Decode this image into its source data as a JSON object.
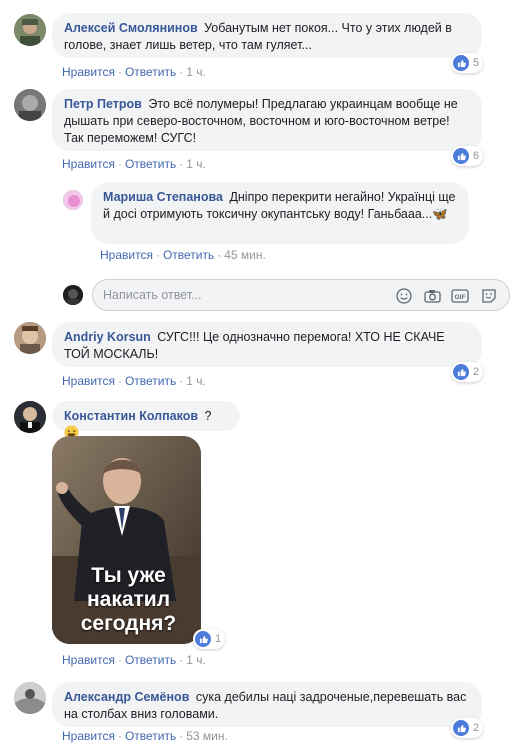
{
  "comments": [
    {
      "author": "Алексей Смолянинов",
      "text": "Уобанутым нет покоя... Что у этих людей в голове, знает лишь ветер, что там гуляет...",
      "like_label": "Нравится",
      "reply_label": "Ответить",
      "time": "1 ч.",
      "reactions": "5"
    },
    {
      "author": "Петр Петров",
      "text": "Это всё полумеры! Предлагаю украинцам вообще не дышать при северо-восточном, восточном и юго-восточном ветре! Так переможем! СУГС!",
      "like_label": "Нравится",
      "reply_label": "Ответить",
      "time": "1 ч.",
      "reactions": "6"
    },
    {
      "author": "Andriy Korsun",
      "text": "СУГС!!! Це однозначно перемога! ХТО НЕ СКАЧЕ ТОЙ МОСКАЛЬ!",
      "like_label": "Нравится",
      "reply_label": "Ответить",
      "time": "1 ч.",
      "reactions": "2"
    },
    {
      "author": "Константин Колпаков",
      "text": "?",
      "like_label": "Нравится",
      "reply_label": "Ответить",
      "time": "1 ч.",
      "reactions": "1",
      "photo_caption": "Ты уже накатил сегодня?"
    },
    {
      "author": "Александр Семёнов",
      "text": "сука дебилы нацi задроченые,перевешать вас на столбах вниз головами.",
      "like_label": "Нравится",
      "reply_label": "Ответить",
      "time": "53 мин.",
      "reactions": "2"
    }
  ],
  "reply": {
    "author": "Мариша Степанова",
    "text": "Дніпро перекрити негайно! Українці ще й досі отримують токсичну окупантську воду! Ганьбааа...🦋",
    "like_label": "Нравится",
    "reply_label": "Ответить",
    "time": "45 мин."
  },
  "reply_input": {
    "placeholder": "Написать ответ..."
  },
  "icons": [
    "like-icon",
    "emoji-icon",
    "camera-icon",
    "gif-icon",
    "sticker-icon"
  ],
  "colors": {
    "author": "#385898",
    "action": "#4267b2",
    "bubble": "#f2f3f5",
    "like": "#4c7bd9"
  }
}
